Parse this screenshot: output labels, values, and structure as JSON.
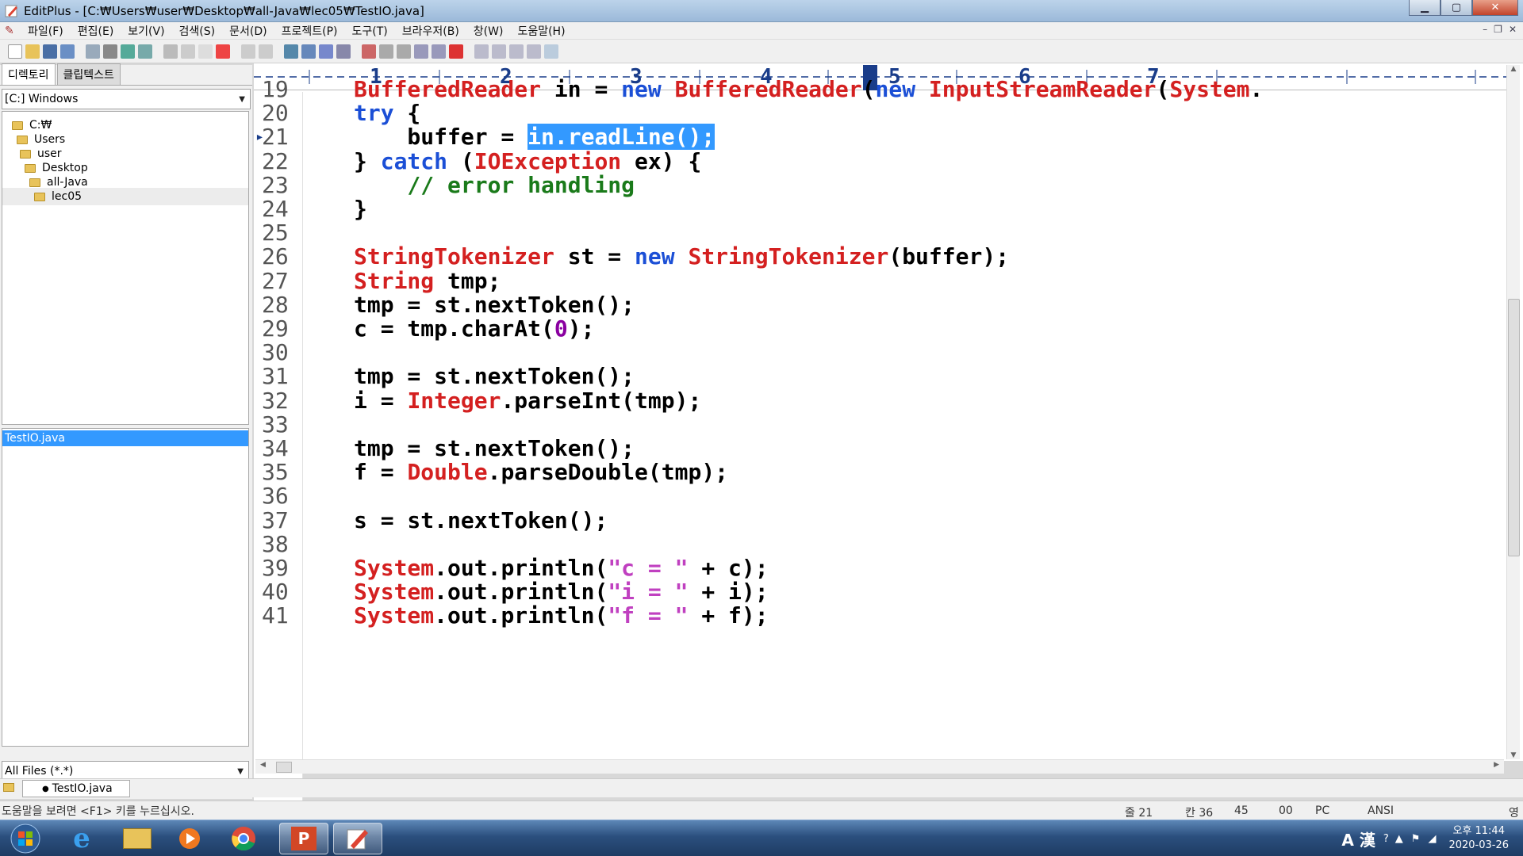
{
  "window": {
    "title": "EditPlus - [C:₩Users₩user₩Desktop₩all-Java₩lec05₩TestIO.java]"
  },
  "menu": [
    "파일(F)",
    "편집(E)",
    "보기(V)",
    "검색(S)",
    "문서(D)",
    "프로젝트(P)",
    "도구(T)",
    "브라우저(B)",
    "창(W)",
    "도움말(H)"
  ],
  "left_panel": {
    "tabs": [
      "디렉토리",
      "클립텍스트"
    ],
    "drive": "[C:] Windows",
    "tree": [
      "C:₩",
      "Users",
      "user",
      "Desktop",
      "all-Java",
      "lec05"
    ],
    "files": [
      "TestIO.java"
    ],
    "filter": "All Files (*.*)"
  },
  "ruler": {
    "numbers": [
      "1",
      "2",
      "3",
      "4",
      "5",
      "6",
      "7"
    ]
  },
  "editor": {
    "lines": [
      {
        "n": "19",
        "code": "BufferedReader in = new BufferedReader(new InputStreamReader(System."
      },
      {
        "n": "20",
        "code": "try {"
      },
      {
        "n": "21",
        "code": "    buffer = in.readLine();"
      },
      {
        "n": "22",
        "code": "} catch (IOException ex) {"
      },
      {
        "n": "23",
        "code": "    // error handling"
      },
      {
        "n": "24",
        "code": "}"
      },
      {
        "n": "25",
        "code": ""
      },
      {
        "n": "26",
        "code": "StringTokenizer st = new StringTokenizer(buffer);"
      },
      {
        "n": "27",
        "code": "String tmp;"
      },
      {
        "n": "28",
        "code": "tmp = st.nextToken();"
      },
      {
        "n": "29",
        "code": "c = tmp.charAt(0);"
      },
      {
        "n": "30",
        "code": ""
      },
      {
        "n": "31",
        "code": "tmp = st.nextToken();"
      },
      {
        "n": "32",
        "code": "i = Integer.parseInt(tmp);"
      },
      {
        "n": "33",
        "code": ""
      },
      {
        "n": "34",
        "code": "tmp = st.nextToken();"
      },
      {
        "n": "35",
        "code": "f = Double.parseDouble(tmp);"
      },
      {
        "n": "36",
        "code": ""
      },
      {
        "n": "37",
        "code": "s = st.nextToken();"
      },
      {
        "n": "38",
        "code": ""
      },
      {
        "n": "39",
        "code": "System.out.println(\"c = \" + c);"
      },
      {
        "n": "40",
        "code": "System.out.println(\"i = \" + i);"
      },
      {
        "n": "41",
        "code": "System.out.println(\"f = \" + f);"
      }
    ],
    "selected_text": "in.readLine();"
  },
  "doc_tab": "TestIO.java",
  "status": {
    "hint": "도움말을 보려면 <F1> 키를 누르십시오.",
    "line": "줄 21",
    "col": "칸 36",
    "count": "45",
    "code": "00",
    "mode": "PC",
    "encoding": "ANSI",
    "ime": "영"
  },
  "taskbar": {
    "ime_lang": "A 漢",
    "clock_time": "오후 11:44",
    "clock_date": "2020-03-26"
  },
  "colors": {
    "keyword": "#1b4fd6",
    "type": "#d42020",
    "comment": "#1a7a1a",
    "string": "#c040c0",
    "selection": "#3399ff"
  }
}
